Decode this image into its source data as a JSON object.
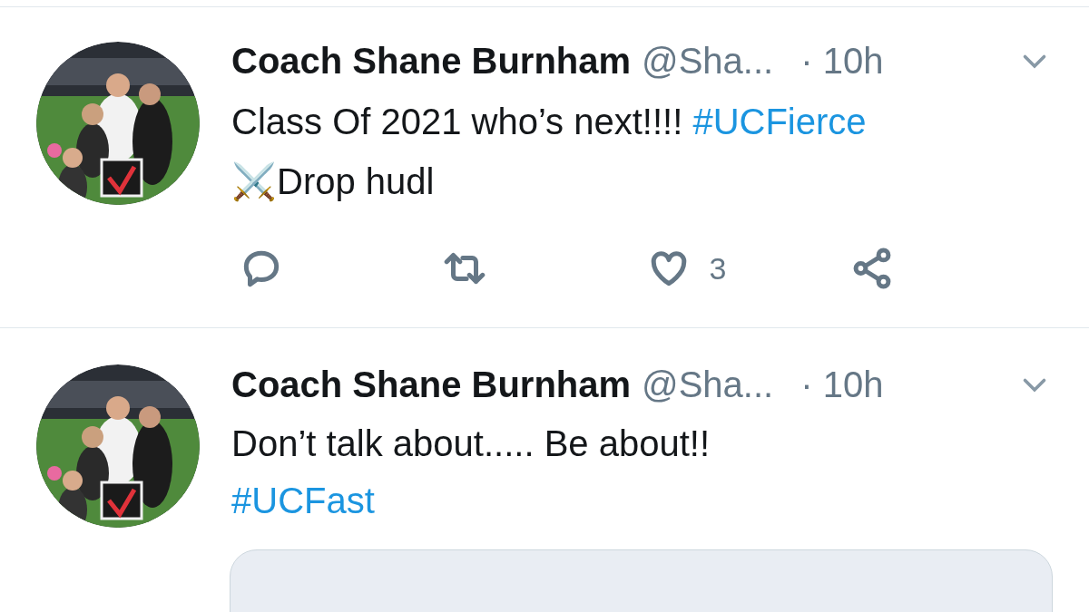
{
  "tweets": [
    {
      "name": "Coach Shane Burnham",
      "handle": "@Sha...",
      "time": "· 10h",
      "lines": [
        [
          {
            "kind": "text",
            "text": "Class Of 2021 who’s next!!!! "
          },
          {
            "kind": "hashtag",
            "text": "#UCFierce"
          }
        ],
        [
          {
            "kind": "text",
            "text": "⚔️Drop hudl"
          }
        ]
      ],
      "actions": [
        {
          "kind": "reply"
        },
        {
          "kind": "retweet"
        },
        {
          "kind": "like",
          "count": "3"
        },
        {
          "kind": "share"
        }
      ]
    },
    {
      "name": "Coach Shane Burnham",
      "handle": "@Sha...",
      "time": "· 10h",
      "lines": [
        [
          {
            "kind": "text",
            "text": "Don’t talk about..... Be about!!"
          }
        ],
        [
          {
            "kind": "hashtag",
            "text": "#UCFast"
          }
        ]
      ],
      "media": {
        "kind": "card"
      }
    }
  ]
}
